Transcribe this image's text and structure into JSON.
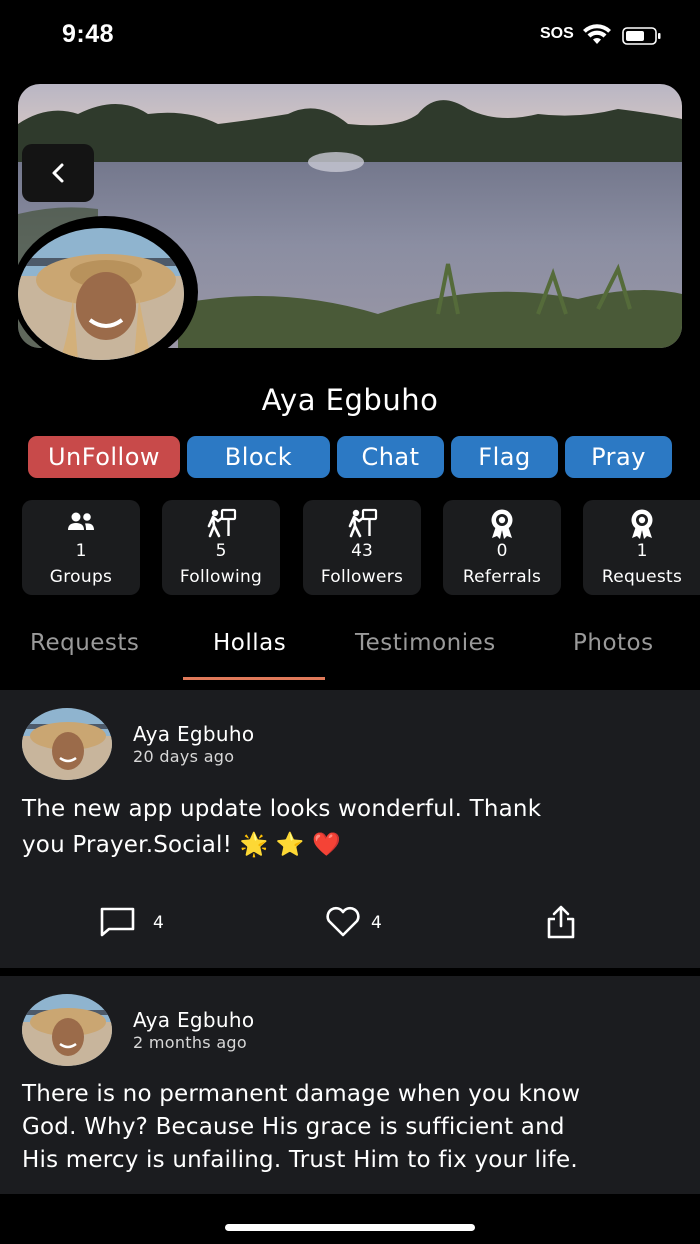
{
  "status_bar": {
    "time": "9:48",
    "sos": "SOS"
  },
  "profile": {
    "name": "Aya Egbuho"
  },
  "actions": [
    "UnFollow",
    "Block",
    "Chat",
    "Flag",
    "Pray"
  ],
  "stats": [
    {
      "icon": "groups-icon",
      "count": "1",
      "label": "Groups"
    },
    {
      "icon": "following-icon",
      "count": "5",
      "label": "Following"
    },
    {
      "icon": "followers-icon",
      "count": "43",
      "label": "Followers"
    },
    {
      "icon": "referrals-badge-icon",
      "count": "0",
      "label": "Referrals"
    },
    {
      "icon": "requests-badge-icon",
      "count": "1",
      "label": "Requests"
    }
  ],
  "tabs": [
    {
      "label": "Requests",
      "active": false
    },
    {
      "label": "Hollas",
      "active": true
    },
    {
      "label": "Testimonies",
      "active": false
    },
    {
      "label": "Photos",
      "active": false
    }
  ],
  "posts": [
    {
      "author": "Aya Egbuho",
      "time": "20 days ago",
      "text_line1": "The new app update looks wonderful. Thank",
      "text_line2": "you Prayer.Social! 🌟 ⭐ ❤️",
      "comments": "4",
      "likes": "4"
    },
    {
      "author": "Aya Egbuho",
      "time": "2 months ago",
      "text_line1": "There is no permanent damage when you know",
      "text_line2": "God. Why? Because His grace is sufficient and",
      "text_line3": "His mercy is unfailing. Trust Him to fix your life."
    }
  ],
  "colors": {
    "unfollow": "#c84a4a",
    "action_blue": "#2c79c4",
    "tab_underline": "#e07a5a",
    "card": "#1b1c1e"
  }
}
